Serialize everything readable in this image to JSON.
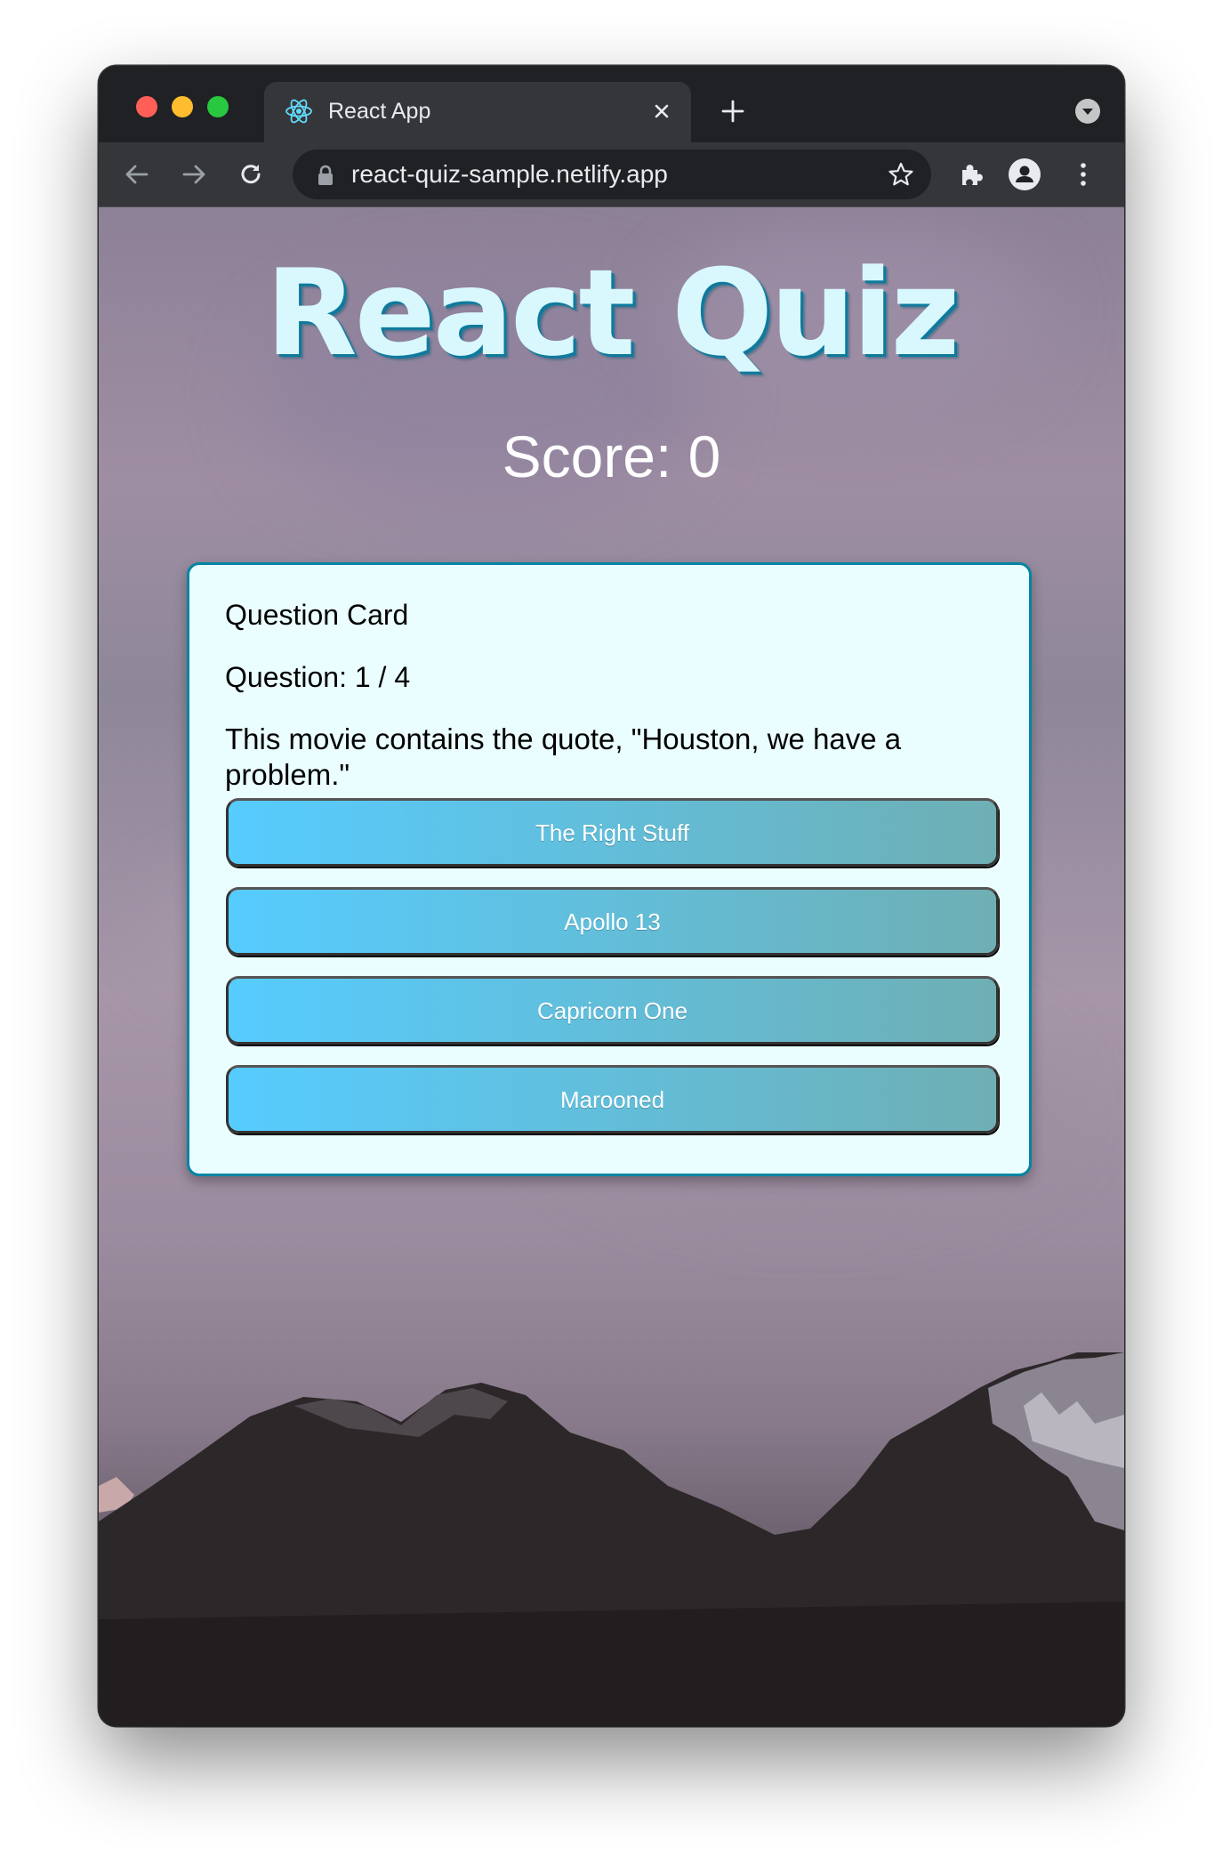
{
  "browser": {
    "tab": {
      "title": "React App",
      "favicon": "react-logo-icon",
      "close": "close-icon"
    },
    "new_tab_icon": "plus-icon",
    "toolbar": {
      "back_icon": "arrow-left-icon",
      "forward_icon": "arrow-right-icon",
      "reload_icon": "reload-icon",
      "lock_icon": "lock-icon",
      "url": "react-quiz-sample.netlify.app",
      "bookmark_icon": "star-icon",
      "extensions_icon": "puzzle-icon",
      "profile_icon": "person-icon",
      "menu_icon": "kebab-menu-icon"
    },
    "traffic_lights": [
      "#ff5f57",
      "#febc2e",
      "#28c840"
    ]
  },
  "app": {
    "title": "React Quiz",
    "score_text": "Score: 0",
    "card": {
      "heading": "Question Card",
      "number_text": "Question: 1 / 4",
      "question": "This movie contains the quote, \"Houston, we have a problem.\"",
      "answers": [
        "The Right Stuff",
        "Apollo 13",
        "Capricorn One",
        "Marooned"
      ]
    },
    "colors": {
      "title_fill": "#d8f8fe",
      "title_shadow": "#0e7a9c",
      "card_bg": "#ebfeff",
      "card_border": "#0085a3",
      "button_gradient_start": "#56ccff",
      "button_gradient_end": "#6eafb4"
    }
  }
}
